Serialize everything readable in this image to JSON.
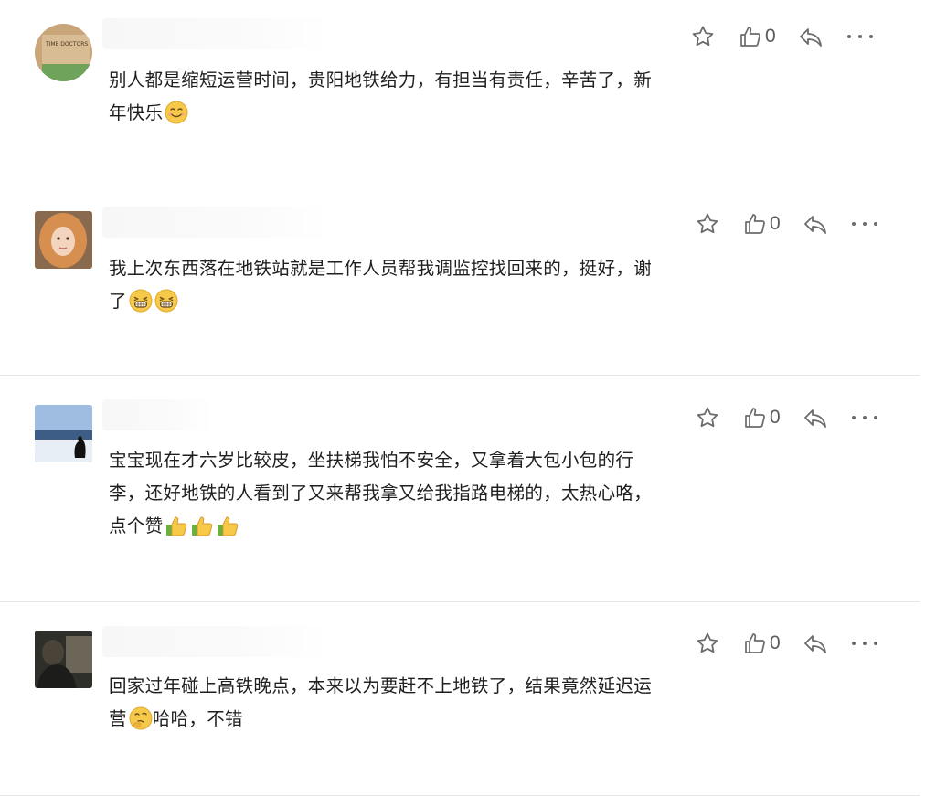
{
  "comments": [
    {
      "text": "别人都是缩短运营时间，贵阳地铁给力，有担当有责任，辛苦了，新年快乐",
      "emoji": [
        "smile-emoji"
      ],
      "likes": "0",
      "avatar_label": "TIME DOCTORS"
    },
    {
      "text": "我上次东西落在地铁站就是工作人员帮我调监控找回来的，挺好，谢了",
      "emoji": [
        "grin-emoji",
        "grin-emoji"
      ],
      "likes": "0"
    },
    {
      "text": "宝宝现在才六岁比较皮，坐扶梯我怕不安全，又拿着大包小包的行李，还好地铁的人看到了又来帮我拿又给我指路电梯的，太热心咯，点个赞",
      "emoji": [
        "thumbs-up-emoji",
        "thumbs-up-emoji",
        "thumbs-up-emoji"
      ],
      "likes": "0"
    },
    {
      "text_before": "回家过年碰上高铁晚点，本来以为要赶不上地铁了，结果竟然延迟运营",
      "text_after": "哈哈，不错",
      "emoji": [
        "thinking-emoji"
      ],
      "likes": "0"
    }
  ],
  "colors": {
    "icon": "#6b6b6b",
    "divider": "#e6e6e6",
    "emoji_yellow": "#f6c94a"
  }
}
